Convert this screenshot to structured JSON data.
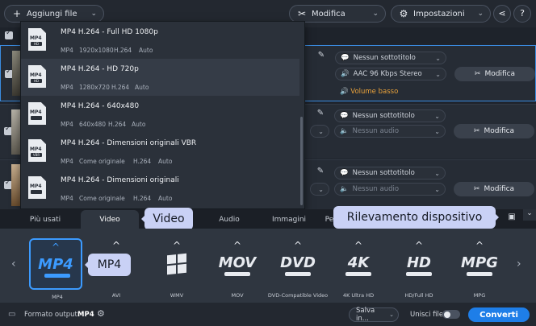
{
  "toolbar": {
    "add_files": "Aggiungi file",
    "edit": "Modifica",
    "settings": "Impostazioni"
  },
  "list": {
    "header_partial": "3"
  },
  "files": [
    {
      "subtitle": "Nessun sottotitolo",
      "audio": "AAC 96 Kbps Stereo",
      "edit": "Modifica",
      "warning": "Volume basso"
    },
    {
      "subtitle": "Nessun sottotitolo",
      "audio": "Nessun audio",
      "edit": "Modifica"
    },
    {
      "subtitle": "Nessun sottotitolo",
      "audio": "Nessun audio",
      "edit": "Modifica"
    }
  ],
  "presets": [
    {
      "title": "MP4 H.264 - Full HD 1080p",
      "format": "MP4",
      "resolution": "1920x1080",
      "codec": "H.264",
      "fps": "Auto",
      "icon_text": "HD"
    },
    {
      "title": "MP4 H.264 - HD 720p",
      "format": "MP4",
      "resolution": "1280x720",
      "codec": "H.264",
      "fps": "Auto",
      "icon_text": "HD"
    },
    {
      "title": "MP4 H.264 - 640x480",
      "format": "MP4",
      "resolution": "640x480",
      "codec": "H.264",
      "fps": "Auto",
      "icon_text": ""
    },
    {
      "title": "MP4 H.264 - Dimensioni originali VBR",
      "format": "MP4",
      "resolution": "Come originale",
      "codec": "H.264",
      "fps": "Auto",
      "icon_text": "VBR"
    },
    {
      "title": "MP4 H.264 - Dimensioni originali",
      "format": "MP4",
      "resolution": "Come originale",
      "codec": "H.264",
      "fps": "Auto",
      "icon_text": ""
    }
  ],
  "tabs": {
    "popular": "Più usati",
    "video": "Video",
    "audio": "Audio",
    "images": "Immagini",
    "devices_partial": "Pe"
  },
  "callouts": {
    "video": "Video",
    "device": "Rilevamento dispositivo",
    "mp4": "MP4"
  },
  "formats": [
    {
      "logo": "MP4",
      "label": "MP4",
      "sub": "VIDEO"
    },
    {
      "logo": "AVI",
      "label": "AVI",
      "sub": ""
    },
    {
      "logo": "",
      "label": "WMV",
      "sub": ""
    },
    {
      "logo": "MOV",
      "label": "MOV",
      "sub": "VIDEO"
    },
    {
      "logo": "DVD",
      "label": "DVD-Compatible Video",
      "sub": "VIDEO"
    },
    {
      "logo": "4K",
      "label": "4K Ultra HD",
      "sub": "VIDEO"
    },
    {
      "logo": "HD",
      "label": "HD/Full HD",
      "sub": "VIDEO"
    },
    {
      "logo": "MPG",
      "label": "MPG",
      "sub": "VIDEO"
    }
  ],
  "bottom": {
    "output_label": "Formato output:",
    "output_value": "MP4",
    "save_to": "Salva in...",
    "merge": "Unisci file:",
    "convert": "Converti"
  },
  "colors": {
    "accent": "#1e7ee8",
    "selection": "#3c9bff",
    "callout": "#c9d1f5",
    "warning": "#e9a23b"
  },
  "icons": [
    "plus-icon",
    "tools-icon",
    "settings-icon",
    "share-icon",
    "help-icon",
    "pencil-icon",
    "speech-bubble-icon",
    "speaker-icon",
    "warning-icon",
    "device-detect-icon",
    "gear-icon",
    "folder-icon"
  ]
}
